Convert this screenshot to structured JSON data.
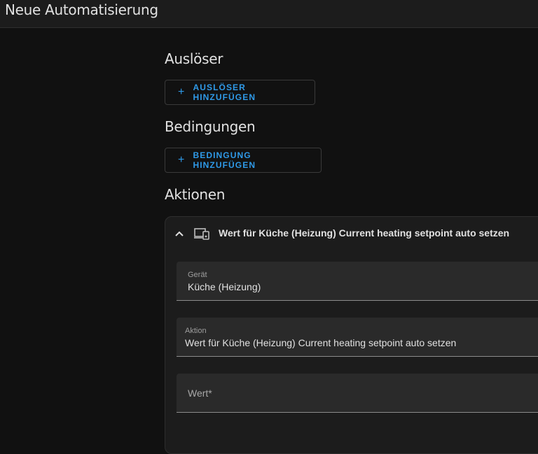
{
  "header": {
    "title": "Neue Automatisierung"
  },
  "triggers": {
    "heading": "Auslöser",
    "add_label": "AUSLÖSER HINZUFÜGEN"
  },
  "conditions": {
    "heading": "Bedingungen",
    "add_label": "BEDINGUNG HINZUFÜGEN"
  },
  "actions": {
    "heading": "Aktionen",
    "card": {
      "title": "Wert für Küche (Heizung) Current heating setpoint auto setzen",
      "device_field": {
        "label": "Gerät",
        "value": "Küche (Heizung)"
      },
      "action_field": {
        "label": "Aktion",
        "value": "Wert für Küche (Heizung) Current heating setpoint auto setzen"
      },
      "value_field": {
        "placeholder": "Wert*"
      }
    }
  },
  "icons": {
    "plus": "plus-icon",
    "chevron": "chevron-up-icon",
    "device": "devices-icon"
  },
  "colors": {
    "accent": "#2f9ae8",
    "background": "#111111",
    "surface": "#1c1c1c",
    "field": "#2a2a2a"
  }
}
